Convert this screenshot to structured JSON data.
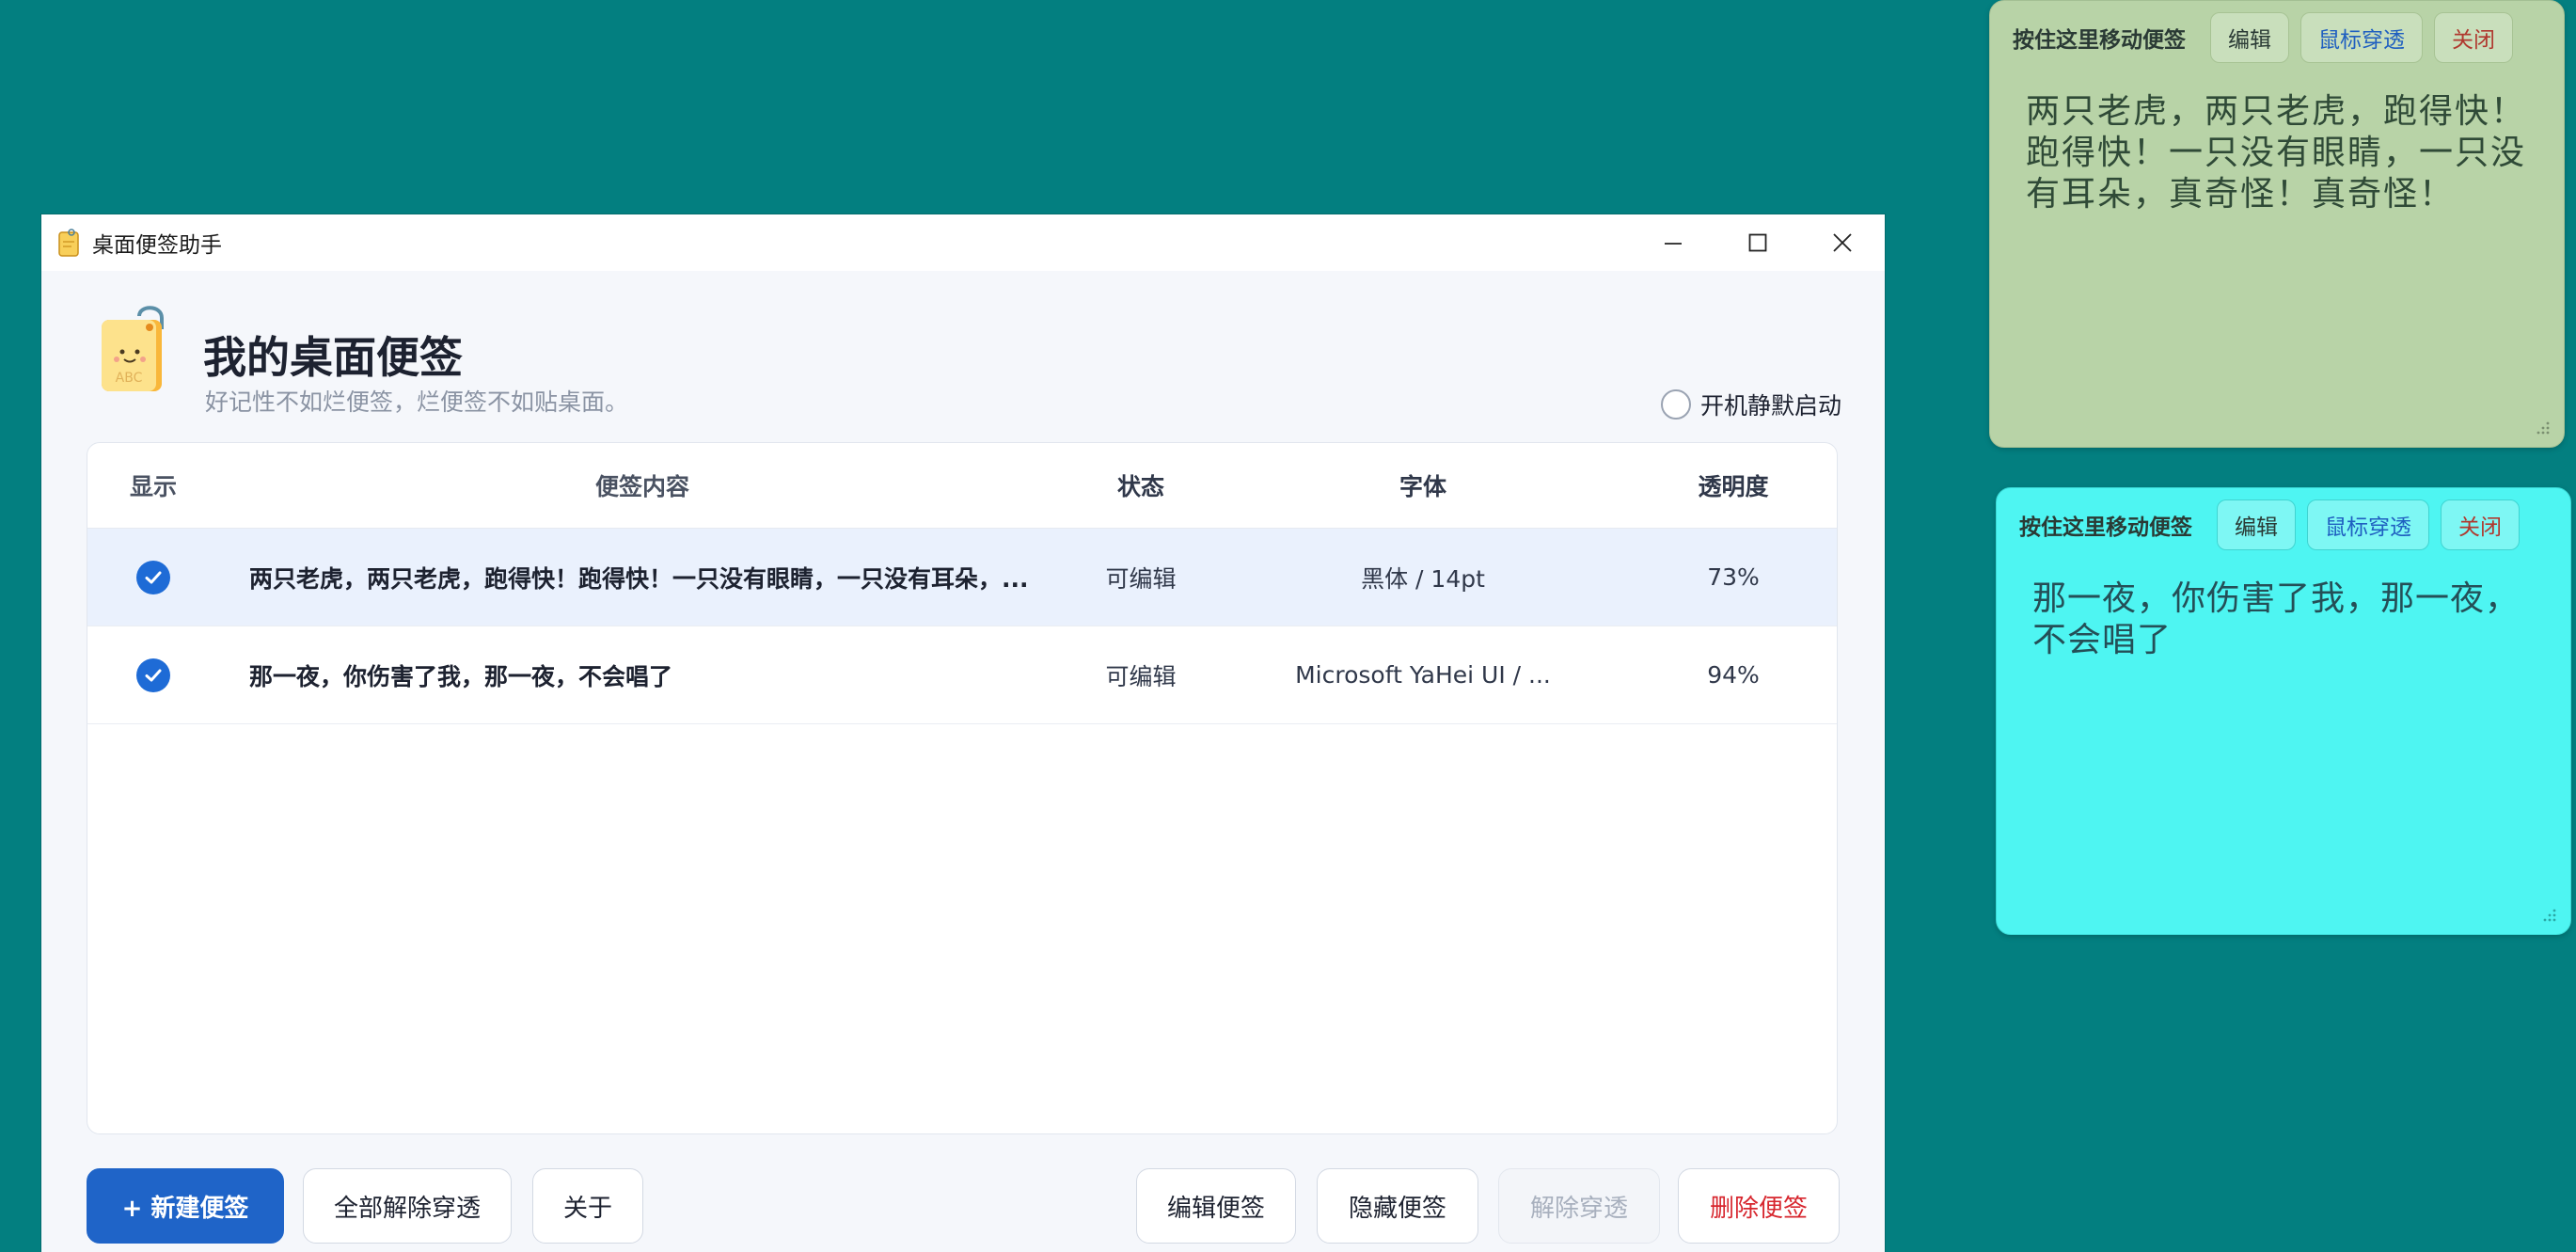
{
  "window": {
    "title": "桌面便签助手",
    "minimize_glyph": "−",
    "maximize_glyph": "☐",
    "close_glyph": "✕"
  },
  "header": {
    "title": "我的桌面便签",
    "subtitle": "好记性不如烂便签，烂便签不如贴桌面。",
    "startup_option": {
      "label": "开机静默启动",
      "checked": false
    }
  },
  "table": {
    "columns": {
      "show": "显示",
      "content": "便签内容",
      "status": "状态",
      "font": "字体",
      "opacity": "透明度"
    },
    "rows": [
      {
        "visible": true,
        "selected": true,
        "content": "两只老虎，两只老虎，跑得快！跑得快！一只没有眼睛，一只没有耳朵，...",
        "status": "可编辑",
        "font": "黑体 / 14pt",
        "opacity": "73%"
      },
      {
        "visible": true,
        "selected": false,
        "content": "那一夜，你伤害了我，那一夜，不会唱了",
        "status": "可编辑",
        "font": "Microsoft YaHei UI / ...",
        "opacity": "94%"
      }
    ]
  },
  "footer": {
    "new_note": "+  新建便签",
    "release_all": "全部解除穿透",
    "about": "关于",
    "edit_note": "编辑便签",
    "hide_note": "隐藏便签",
    "release_passthrough": "解除穿透",
    "delete_note": "删除便签"
  },
  "notes": [
    {
      "drag_label": "按住这里移动便签",
      "edit_label": "编辑",
      "passthrough_label": "鼠标穿透",
      "close_label": "关闭",
      "text": "两只老虎，两只老虎，跑得快！跑得快！一只没有眼睛，一只没有耳朵，真奇怪！真奇怪！",
      "color": "#b8d3a7"
    },
    {
      "drag_label": "按住这里移动便签",
      "edit_label": "编辑",
      "passthrough_label": "鼠标穿透",
      "close_label": "关闭",
      "text": "那一夜，你伤害了我，那一夜，不会唱了",
      "color": "#4ef5f2"
    }
  ],
  "colors": {
    "desktop": "#037f80",
    "accent": "#1f64c8",
    "danger": "#d7262e",
    "selected_row": "#eaf1fd"
  }
}
